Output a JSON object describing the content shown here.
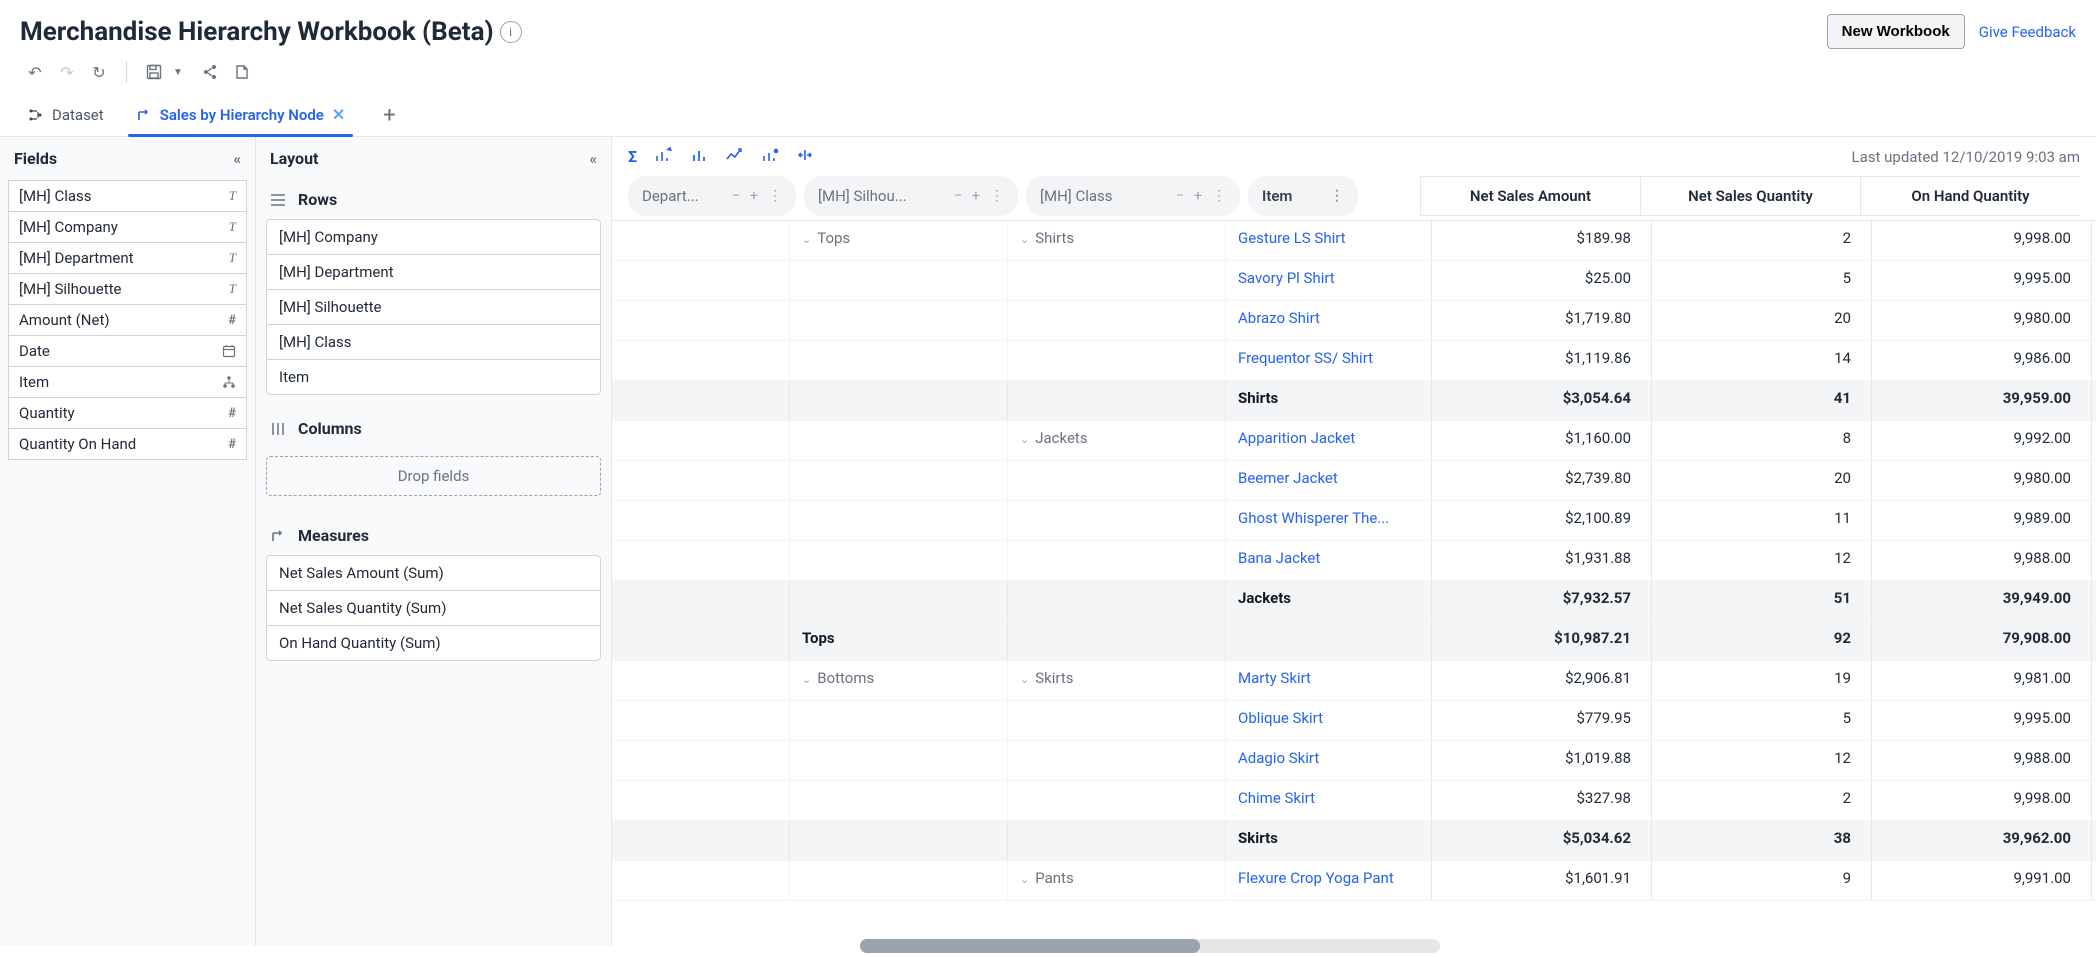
{
  "header": {
    "title": "Merchandise Hierarchy Workbook (Beta)",
    "new_workbook": "New Workbook",
    "give_feedback": "Give Feedback"
  },
  "tabs": {
    "dataset": "Dataset",
    "active": "Sales by Hierarchy Node"
  },
  "fields_panel": {
    "title": "Fields",
    "items": [
      {
        "label": "[MH] Class",
        "type": "T"
      },
      {
        "label": "[MH] Company",
        "type": "T"
      },
      {
        "label": "[MH] Department",
        "type": "T"
      },
      {
        "label": "[MH] Silhouette",
        "type": "T"
      },
      {
        "label": "Amount (Net)",
        "type": "#"
      },
      {
        "label": "Date",
        "type": "cal"
      },
      {
        "label": "Item",
        "type": "hier"
      },
      {
        "label": "Quantity",
        "type": "#"
      },
      {
        "label": "Quantity On Hand",
        "type": "#"
      }
    ]
  },
  "layout_panel": {
    "title": "Layout",
    "rows_title": "Rows",
    "rows": [
      "[MH] Company",
      "[MH] Department",
      "[MH] Silhouette",
      "[MH] Class",
      "Item"
    ],
    "columns_title": "Columns",
    "drop_fields": "Drop fields",
    "measures_title": "Measures",
    "measures": [
      "Net Sales Amount (Sum)",
      "Net Sales Quantity (Sum)",
      "On Hand Quantity (Sum)"
    ]
  },
  "grid": {
    "last_updated_label": "Last updated",
    "last_updated_value": "12/10/2019 9:03 am",
    "col_chips": [
      "Depart...",
      "[MH] Silhou...",
      "[MH] Class",
      "Item"
    ],
    "measure_headers": [
      "Net Sales Amount",
      "Net Sales Quantity",
      "On Hand Quantity"
    ],
    "rows": [
      {
        "dept": "",
        "sil": "Tops",
        "cls": "Shirts",
        "item": "Gesture LS Shirt",
        "vals": [
          "$189.98",
          "2",
          "9,998.00"
        ],
        "sil_first": true,
        "cls_first": true
      },
      {
        "item": "Savory Pl Shirt",
        "vals": [
          "$25.00",
          "5",
          "9,995.00"
        ]
      },
      {
        "item": "Abrazo Shirt",
        "vals": [
          "$1,719.80",
          "20",
          "9,980.00"
        ]
      },
      {
        "item": "Frequentor SS/ Shirt",
        "vals": [
          "$1,119.86",
          "14",
          "9,986.00"
        ]
      },
      {
        "subtotal": true,
        "item": "Shirts",
        "vals": [
          "$3,054.64",
          "41",
          "39,959.00"
        ]
      },
      {
        "cls": "Jackets",
        "item": "Apparition Jacket",
        "vals": [
          "$1,160.00",
          "8",
          "9,992.00"
        ],
        "cls_first": true
      },
      {
        "item": "Beemer Jacket",
        "vals": [
          "$2,739.80",
          "20",
          "9,980.00"
        ]
      },
      {
        "item": "Ghost Whisperer The...",
        "vals": [
          "$2,100.89",
          "11",
          "9,989.00"
        ]
      },
      {
        "item": "Bana Jacket",
        "vals": [
          "$1,931.88",
          "12",
          "9,988.00"
        ]
      },
      {
        "subtotal": true,
        "item": "Jackets",
        "vals": [
          "$7,932.57",
          "51",
          "39,949.00"
        ]
      },
      {
        "subtotal": true,
        "sil_label": "Tops",
        "vals": [
          "$10,987.21",
          "92",
          "79,908.00"
        ],
        "sil_total": true
      },
      {
        "sil": "Bottoms",
        "cls": "Skirts",
        "item": "Marty Skirt",
        "vals": [
          "$2,906.81",
          "19",
          "9,981.00"
        ],
        "sil_first": true,
        "cls_first": true
      },
      {
        "item": "Oblique Skirt",
        "vals": [
          "$779.95",
          "5",
          "9,995.00"
        ]
      },
      {
        "item": "Adagio Skirt",
        "vals": [
          "$1,019.88",
          "12",
          "9,988.00"
        ]
      },
      {
        "item": "Chime Skirt",
        "vals": [
          "$327.98",
          "2",
          "9,998.00"
        ]
      },
      {
        "subtotal": true,
        "item": "Skirts",
        "vals": [
          "$5,034.62",
          "38",
          "39,962.00"
        ]
      },
      {
        "cls": "Pants",
        "item": "Flexure Crop Yoga Pant",
        "vals": [
          "$1,601.91",
          "9",
          "9,991.00"
        ],
        "cls_first": true
      }
    ]
  }
}
